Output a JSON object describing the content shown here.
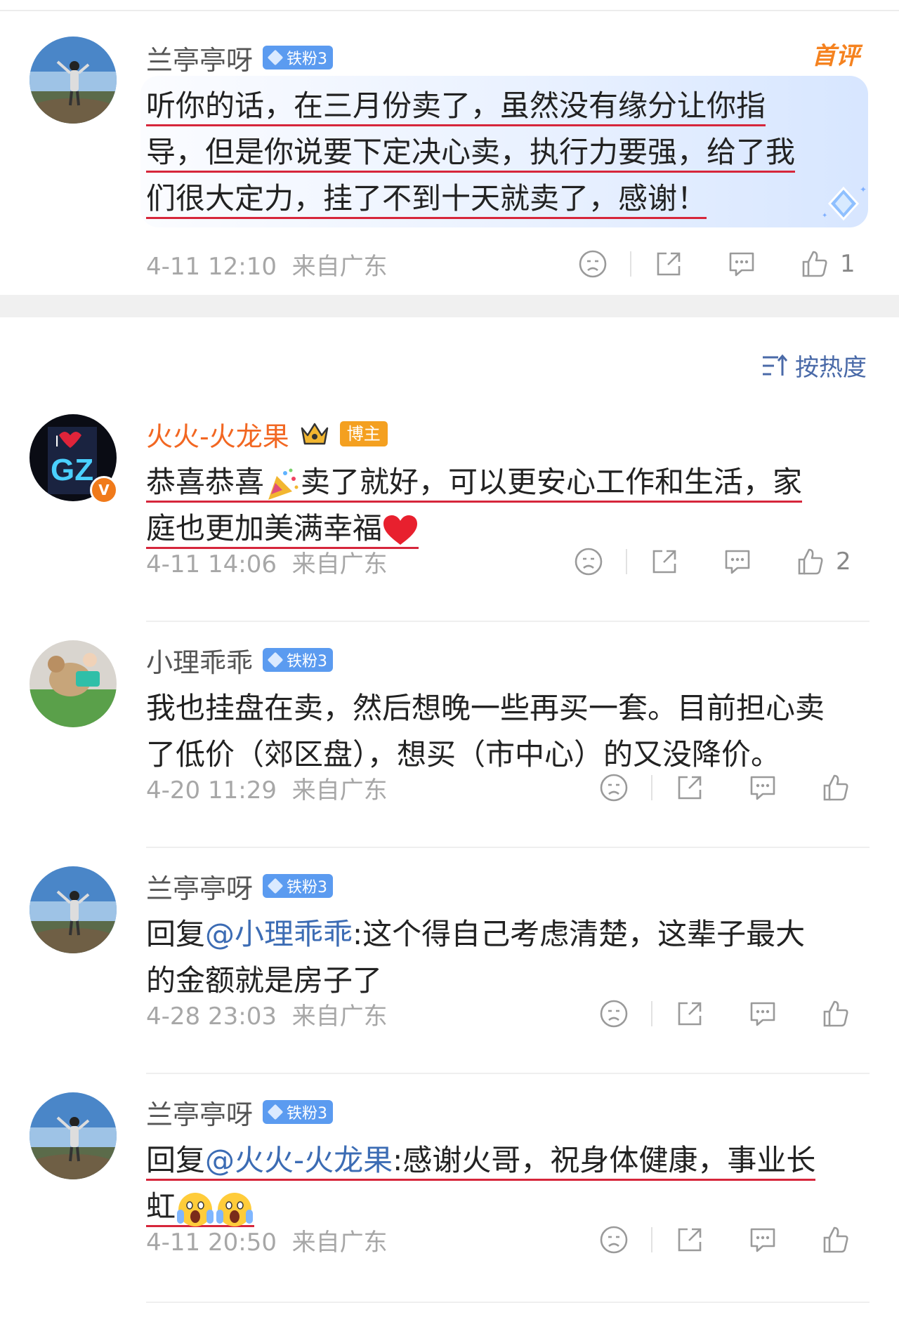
{
  "sort": {
    "label": "按热度"
  },
  "comments": [
    {
      "name": "兰亭亭呀",
      "badge": "铁粉3",
      "tag": "首评",
      "text": "听你的话，在三月份卖了，虽然没有缘分让你指导，但是你说要下定决心卖，执行力要强，给了我们很大定力，挂了不到十天就卖了，感谢！",
      "lines": [
        "听你的话，在三月份卖了，虽然没有缘分让你指",
        "导，但是你说要下定决心卖，执行力要强，给了我",
        "们很大定力，挂了不到十天就卖了，感谢！"
      ],
      "time": "4-11 12:10",
      "location": "来自广东",
      "likes": "1"
    },
    {
      "name": "火火-火龙果",
      "role": "博主",
      "line1_a": "恭喜恭喜",
      "line1_b": "卖了就好，可以更安心工作和生活，家",
      "line2": "庭也更加美满幸福",
      "time": "4-11 14:06",
      "location": "来自广东",
      "likes": "2"
    },
    {
      "name": "小理乖乖",
      "badge": "铁粉3",
      "lines": [
        "我也挂盘在卖，然后想晚一些再买一套。目前担心卖",
        "了低价（郊区盘），想买（市中心）的又没降价。"
      ],
      "time": "4-20 11:29",
      "location": "来自广东"
    },
    {
      "name": "兰亭亭呀",
      "badge": "铁粉3",
      "reply_prefix": "回复",
      "mention": "@小理乖乖",
      "line1_rest": ":这个得自己考虑清楚，这辈子最大",
      "line2": "的金额就是房子了",
      "time": "4-28 23:03",
      "location": "来自广东"
    },
    {
      "name": "兰亭亭呀",
      "badge": "铁粉3",
      "reply_prefix": "回复",
      "mention": "@火火-火龙果",
      "line1_rest": ":感谢火哥，祝身体健康，事业长",
      "line2": "虹",
      "time": "4-11 20:50",
      "location": "来自广东"
    }
  ]
}
